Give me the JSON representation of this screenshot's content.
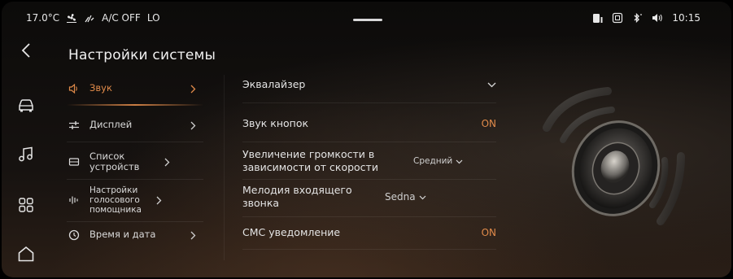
{
  "status": {
    "temperature": "17.0°C",
    "ac": "A/C OFF",
    "fan": "LO",
    "time": "10:15"
  },
  "page_title": "Настройки системы",
  "rail": {
    "items": [
      {
        "name": "back-icon"
      },
      {
        "name": "car-icon"
      },
      {
        "name": "music-icon"
      },
      {
        "name": "apps-icon"
      },
      {
        "name": "home-icon"
      }
    ]
  },
  "submenu": {
    "items": [
      {
        "label": "Звук",
        "icon": "speaker-icon",
        "active": true
      },
      {
        "label": "Дисплей",
        "icon": "display-sliders-icon"
      },
      {
        "label": "Список устройств",
        "icon": "devices-icon"
      },
      {
        "label": "Настройки голосового помощника",
        "icon": "voice-wave-icon"
      },
      {
        "label": "Время и дата",
        "icon": "clock-icon"
      }
    ]
  },
  "settings": {
    "equalizer": {
      "label": "Эквалайзер"
    },
    "button_sound": {
      "label": "Звук кнопок",
      "value": "ON"
    },
    "speed_volume": {
      "label": "Увеличение громкости в зависимости от скорости",
      "value": "Средний"
    },
    "ringtone": {
      "label": "Мелодия входящего звонка",
      "value": "Sedna"
    },
    "sms": {
      "label": "СМС уведомление",
      "value": "ON"
    }
  },
  "colors": {
    "accent": "#e08a4a",
    "text": "#e4e4e4",
    "background": "#0c0b0a"
  }
}
